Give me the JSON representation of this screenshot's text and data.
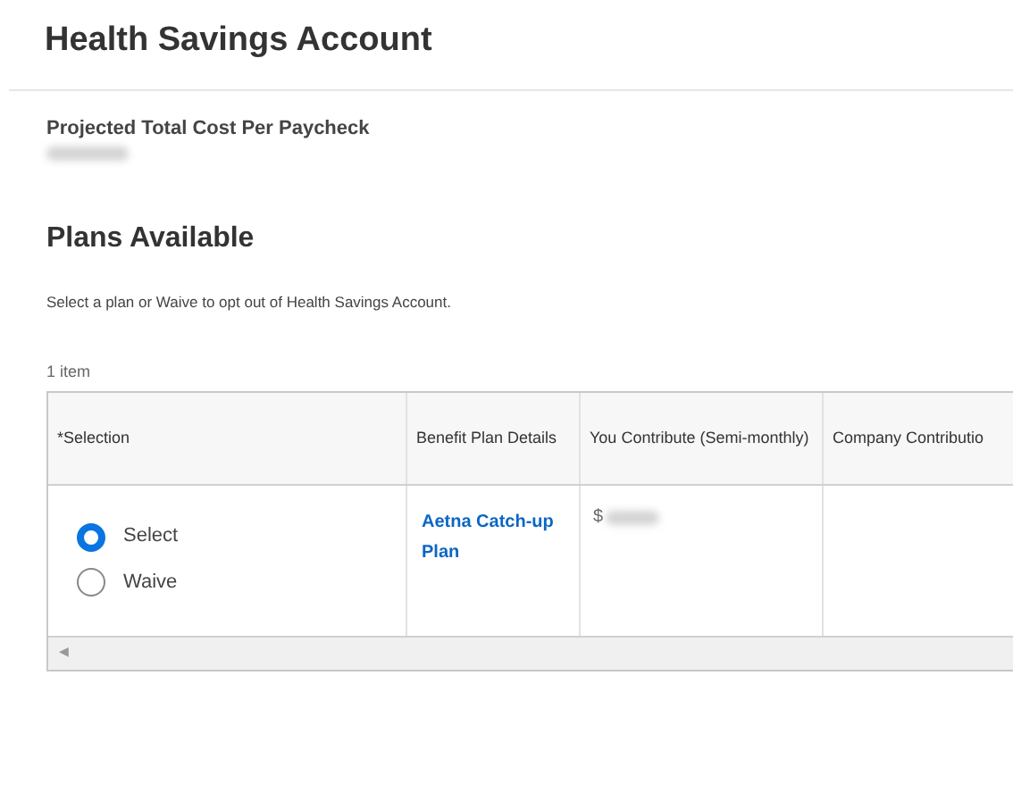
{
  "title": "Health Savings Account",
  "cost": {
    "label": "Projected Total Cost Per Paycheck"
  },
  "plans": {
    "heading": "Plans Available",
    "instructions": "Select a plan or Waive to opt out of Health Savings Account.",
    "count": "1 item",
    "table": {
      "columns": [
        "*Selection",
        "Benefit Plan Details",
        "You Contribute (Semi-monthly)",
        "Company Contributio"
      ],
      "rows": [
        {
          "options": [
            {
              "label": "Select",
              "selected": true
            },
            {
              "label": "Waive",
              "selected": false
            }
          ],
          "plan": "Aetna Catch-up Plan",
          "contribution_prefix": "$"
        }
      ]
    },
    "scroll_arrow": "◀"
  }
}
